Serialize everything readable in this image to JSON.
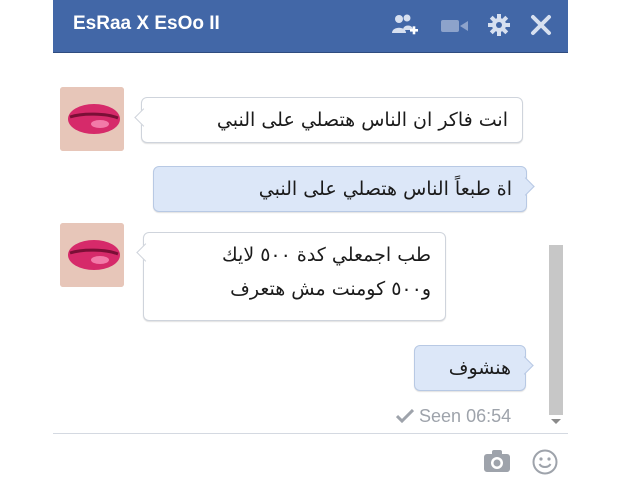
{
  "window": {
    "title": "EsRaa X EsOo II"
  },
  "messages": [
    {
      "side": "received",
      "text": "انت فاكر ان الناس هتصلي على النبي"
    },
    {
      "side": "sent",
      "text": "اة طبعاً الناس هتصلي على النبي"
    },
    {
      "side": "received",
      "lines": [
        "طب اجمعلي كدة ٥٠٠ لايك",
        "و٥٠٠ كومنت مش هتعرف"
      ]
    },
    {
      "side": "sent",
      "text": "هنشوف"
    }
  ],
  "status": {
    "seen": "Seen",
    "time": "06:54"
  },
  "icons": {
    "titlebar": [
      "add-user-icon",
      "video-icon",
      "gear-icon",
      "close-icon"
    ],
    "composer": [
      "camera-icon",
      "smiley-icon"
    ]
  },
  "colors": {
    "header": "#4267a7",
    "sent_bubble": "#dce7f8",
    "received_bubble": "#ffffff"
  }
}
